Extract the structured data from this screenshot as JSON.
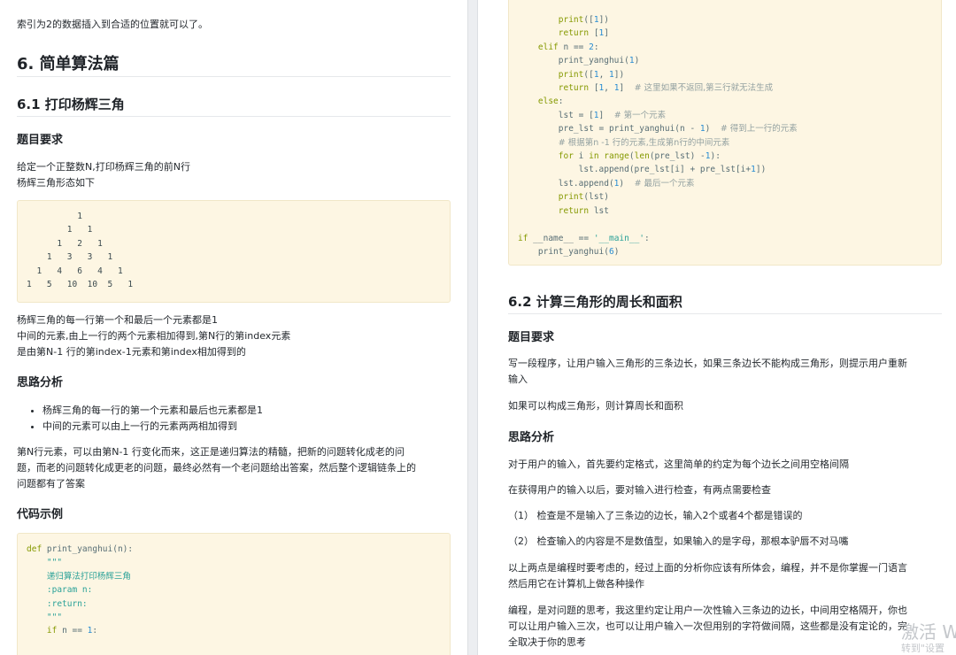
{
  "left": {
    "intro_line": "索引为2的数据插入到合适的位置就可以了。",
    "section_title": "6. 简单算法篇",
    "subsection_title": "6.1 打印杨辉三角",
    "req_heading": "题目要求",
    "req_line1": "给定一个正整数N,打印杨辉三角的前N行",
    "req_line2": "杨辉三角形态如下",
    "triangle_rows": [
      "          1",
      "        1   1",
      "      1   2   1",
      "    1   3   3   1",
      "  1   4   6   4   1",
      "1   5   10  10  5   1"
    ],
    "desc_line1": "杨辉三角的每一行第一个和最后一个元素都是1",
    "desc_line2": "中间的元素,由上一行的两个元素相加得到,第N行的第index元素",
    "desc_line3": "是由第N-1 行的第index-1元素和第index相加得到的",
    "analysis_heading": "思路分析",
    "bullets": [
      "杨辉三角的每一行的第一个元素和最后也元素都是1",
      "中间的元素可以由上一行的元素两两相加得到"
    ],
    "para_line1": "第N行元素，可以由第N-1 行变化而来，这正是递归算法的精髓，把新的问题转化成老的问",
    "para_line2": "题，而老的问题转化成更老的问题，最终必然有一个老问题给出答案，然后整个逻辑链条上的",
    "para_line3": "问题都有了答案",
    "code_heading": "代码示例",
    "code_lines": [
      "def print_yanghui(n):",
      "    \"\"\"",
      "    递归算法打印杨辉三角",
      "    :param n:",
      "    :return:",
      "    \"\"\"",
      "    if n == 1:"
    ]
  },
  "right": {
    "code_lines": [
      "        print([1])",
      "        return [1]",
      "    elif n == 2:",
      "        print_yanghui(1)",
      "        print([1, 1])",
      "        return [1, 1]  # 这里如果不返回,第三行就无法生成",
      "    else:",
      "        lst = [1]  # 第一个元素",
      "        pre_lst = print_yanghui(n - 1)  # 得到上一行的元素",
      "        # 根据第n -1 行的元素,生成第n行的中间元素",
      "        for i in range(len(pre_lst) -1):",
      "            lst.append(pre_lst[i] + pre_lst[i+1])",
      "        lst.append(1)  # 最后一个元素",
      "        print(lst)",
      "        return lst",
      "",
      "if __name__ == '__main__':",
      "    print_yanghui(6)"
    ],
    "subsection_title": "6.2 计算三角形的周长和面积",
    "req_heading": "题目要求",
    "req_line1": "写一段程序，让用户输入三角形的三条边长，如果三条边长不能构成三角形，则提示用户重新",
    "req_line2": "输入",
    "req_line3": "如果可以构成三角形，则计算周长和面积",
    "analysis_heading": "思路分析",
    "analysis_p1": "对于用户的输入，首先要约定格式，这里简单的约定为每个边长之间用空格间隔",
    "analysis_p2": "在获得用户的输入以后，要对输入进行检查，有两点需要检查",
    "check1": "（1）  检查是不是输入了三条边的边长，输入2个或者4个都是错误的",
    "check2": "（2）  检查输入的内容是不是数值型，如果输入的是字母，那根本驴唇不对马嘴",
    "summary_line1": "以上两点是编程时要考虑的，经过上面的分析你应该有所体会，编程，并不是你掌握一门语言",
    "summary_line2": "然后用它在计算机上做各种操作",
    "final_line1": "编程，是对问题的思考，我这里约定让用户一次性输入三条边的边长，中间用空格隔开，你也",
    "final_line2": "可以让用户输入三次，也可以让用户输入一次但用别的字符做间隔，这些都是没有定论的，完",
    "final_line3": "全取决于你的思考",
    "watermark_line1": "激活 W",
    "watermark_line2": "转到\"设置"
  }
}
